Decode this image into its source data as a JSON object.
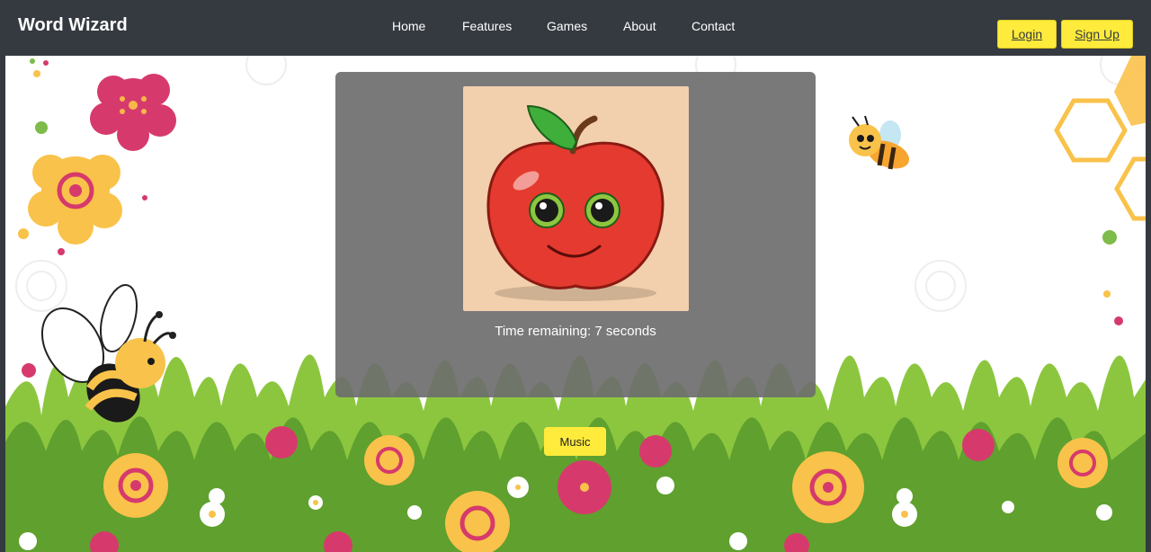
{
  "navbar": {
    "brand": "Word Wizard",
    "links": [
      {
        "label": "Home"
      },
      {
        "label": "Features"
      },
      {
        "label": "Games"
      },
      {
        "label": "About"
      },
      {
        "label": "Contact"
      }
    ],
    "login_label": "Login",
    "signup_label": "Sign Up"
  },
  "game": {
    "image_icon": "smiling-apple-icon",
    "timer_text": "Time remaining: 7 seconds",
    "music_label": "Music"
  },
  "colors": {
    "navbar_bg": "#343a40",
    "accent_yellow": "#ffeb3b",
    "card_bg": "#6e6e6e",
    "image_bg": "#f2d0ad"
  }
}
